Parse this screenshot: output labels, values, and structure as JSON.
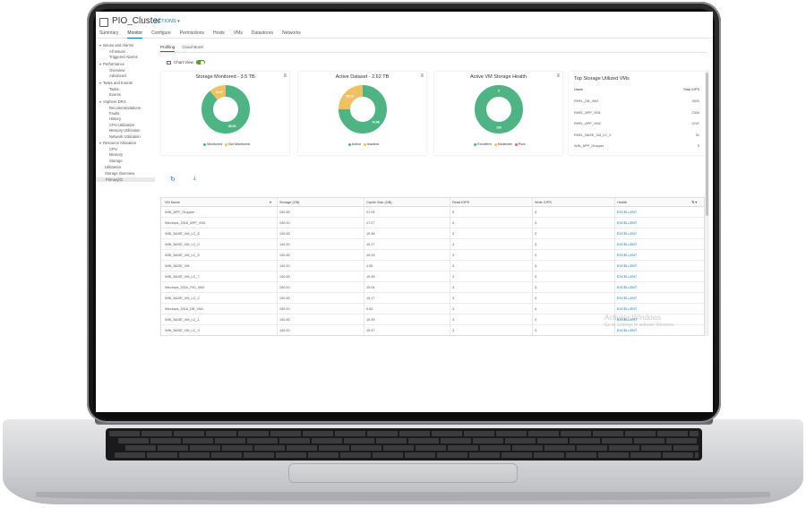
{
  "app": {
    "title": "PIO_Cluster",
    "actions_label": "ACTIONS ▾",
    "tabs": [
      "Summary",
      "Monitor",
      "Configure",
      "Permissions",
      "Hosts",
      "VMs",
      "Datastores",
      "Networks"
    ],
    "active_tab": "Monitor"
  },
  "sidebar": {
    "items": [
      {
        "label": "Issues and Alarms",
        "group": true
      },
      {
        "label": "All Issues"
      },
      {
        "label": "Triggered Alarms"
      },
      {
        "label": "Performance",
        "group": true
      },
      {
        "label": "Overview"
      },
      {
        "label": "Advanced"
      },
      {
        "label": "Tasks and Events",
        "group": true
      },
      {
        "label": "Tasks"
      },
      {
        "label": "Events"
      },
      {
        "label": "vSphere DRS",
        "group": true
      },
      {
        "label": "Recommendations"
      },
      {
        "label": "Faults"
      },
      {
        "label": "History"
      },
      {
        "label": "CPU Utilization"
      },
      {
        "label": "Memory Utilization"
      },
      {
        "label": "Network Utilization"
      },
      {
        "label": "Resource Allocation",
        "group": true
      },
      {
        "label": "CPU"
      },
      {
        "label": "Memory"
      },
      {
        "label": "Storage"
      },
      {
        "label": "Utilization"
      },
      {
        "label": "Storage Overview"
      },
      {
        "label": "PrimaryIO",
        "selected": true
      }
    ]
  },
  "subtabs": [
    "Profiling",
    "Cloud Burst"
  ],
  "chart_view_label": "Chart View",
  "chart_view_on": true,
  "cards": [
    {
      "title": "Storage Monitored - 3.5 TB",
      "segments": [
        {
          "label": "Monitored",
          "value": 88.53,
          "color": "#4fb483"
        },
        {
          "label": "Not Monitored",
          "value": 11.47,
          "color": "#f0c160"
        }
      ],
      "labels": [
        "88.53",
        "11.47"
      ]
    },
    {
      "title": "Active Dataset - 2.62 TB",
      "segments": [
        {
          "label": "Active",
          "value": 74.86,
          "color": "#4fb483"
        },
        {
          "label": "Inactive",
          "value": 25.14,
          "color": "#f0c160"
        }
      ],
      "labels": [
        "74.86",
        "25.14"
      ]
    },
    {
      "title": "Active VM Storage Health",
      "segments": [
        {
          "label": "Excellent",
          "value": 100,
          "color": "#4fb483"
        },
        {
          "label": "Moderate",
          "value": 0,
          "color": "#f0c160"
        },
        {
          "label": "Poor",
          "value": 0,
          "color": "#e06c5c"
        }
      ],
      "labels": [
        "100",
        "0"
      ]
    }
  ],
  "top_vms": {
    "title": "Top Storage Utilized VMs",
    "col_name": "Name",
    "col_iops": "Total IOPS",
    "rows": [
      {
        "name": "RHEL_DB_VM1",
        "iops": "2620"
      },
      {
        "name": "RHEL_APP_VM1",
        "iops": "2304"
      },
      {
        "name": "RHEL_APP_VM2",
        "iops": "2247"
      },
      {
        "name": "RHEL_BASE_VM_LC_0",
        "iops": "31"
      },
      {
        "name": "WIN_APP_Gropper",
        "iops": "9"
      }
    ]
  },
  "icons": {
    "refresh": "refresh-icon",
    "download": "download-icon"
  },
  "grid": {
    "columns": [
      "VM Name",
      "Storage (GB)",
      "Cache Size (GB)",
      "Read IOPS",
      "Write IOPS",
      "Health"
    ],
    "rows": [
      [
        "WIN_APP_Gropper",
        "240.00",
        "21.94",
        "5",
        "4",
        "EXCELLENT"
      ],
      [
        "Windows_2016_APP_VM1",
        "240.00",
        "17.27",
        "4",
        "3",
        "EXCELLENT"
      ],
      [
        "WIN_BASE_VM_LC_6",
        "140.00",
        "15.36",
        "3",
        "3",
        "EXCELLENT"
      ],
      [
        "WIN_BASE_VM_LC_0",
        "140.00",
        "15.17",
        "3",
        "3",
        "EXCELLENT"
      ],
      [
        "WIN_BASE_VM_LC_5",
        "140.00",
        "15.26",
        "3",
        "3",
        "EXCELLENT"
      ],
      [
        "WIN_BASE_VM",
        "140.00",
        "1.05",
        "3",
        "3",
        "EXCELLENT"
      ],
      [
        "WIN_BASE_VM_LC_7",
        "140.00",
        "15.35",
        "3",
        "3",
        "EXCELLENT"
      ],
      [
        "Windows_2016_PIO_VM1",
        "240.00",
        "15.04",
        "3",
        "3",
        "EXCELLENT"
      ],
      [
        "WIN_BASE_VM_LC_2",
        "140.00",
        "15.17",
        "3",
        "3",
        "EXCELLENT"
      ],
      [
        "Windows_2016_DB_VM1",
        "240.00",
        "0.83",
        "3",
        "4",
        "EXCELLENT"
      ],
      [
        "WIN_BASE_VM_LC_1",
        "140.00",
        "15.35",
        "3",
        "3",
        "EXCELLENT"
      ],
      [
        "WIN_BASE_VM_LC_3",
        "140.00",
        "15.37",
        "3",
        "3",
        "EXCELLENT"
      ],
      [
        "WIN_BASE_VM_LC_4",
        "140.00",
        "15.18",
        "3",
        "3",
        "EXCELLENT"
      ]
    ]
  },
  "watermark": {
    "line1": "Activate Windows",
    "line2": "Go to Settings to activate Windows."
  }
}
